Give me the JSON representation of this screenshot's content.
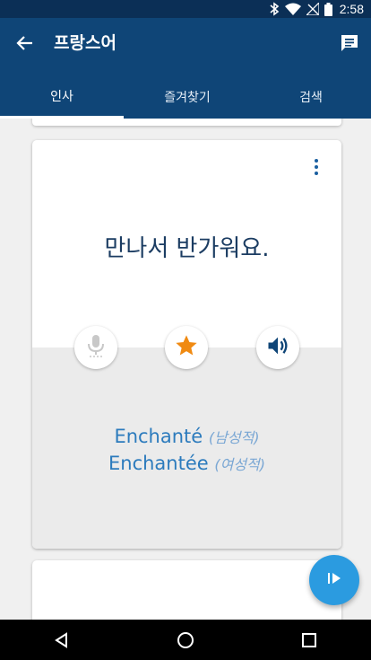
{
  "status_bar": {
    "time": "2:58",
    "icons": [
      "bluetooth-icon",
      "wifi-icon",
      "signal-off-icon",
      "battery-icon"
    ]
  },
  "app_bar": {
    "title": "프랑스어",
    "back_icon": "arrow-back-icon",
    "action_icon": "chat-icon"
  },
  "tabs": [
    {
      "label": "인사",
      "active": true
    },
    {
      "label": "즐겨찾기",
      "active": false
    },
    {
      "label": "검색",
      "active": false
    }
  ],
  "card": {
    "phrase": "만나서 반가워요.",
    "menu_icon": "more-vert-icon",
    "buttons": [
      {
        "icon": "microphone-icon",
        "enabled": false
      },
      {
        "icon": "star-icon",
        "enabled": true
      },
      {
        "icon": "speaker-icon",
        "enabled": true
      }
    ],
    "translations": [
      {
        "text": "Enchanté",
        "gender": "(남성적)"
      },
      {
        "text": "Enchantée",
        "gender": "(여성적)"
      }
    ]
  },
  "fab": {
    "icon": "play-icon"
  },
  "nav_bar": {
    "icons": [
      "nav-back-icon",
      "nav-home-icon",
      "nav-recents-icon"
    ]
  },
  "colors": {
    "status_bar": "#0b2f56",
    "app_bar": "#0f4577",
    "phrase_text": "#1b3c62",
    "translation_text": "#2c7bbd",
    "star": "#f08a12",
    "fab": "#2b9be0"
  }
}
